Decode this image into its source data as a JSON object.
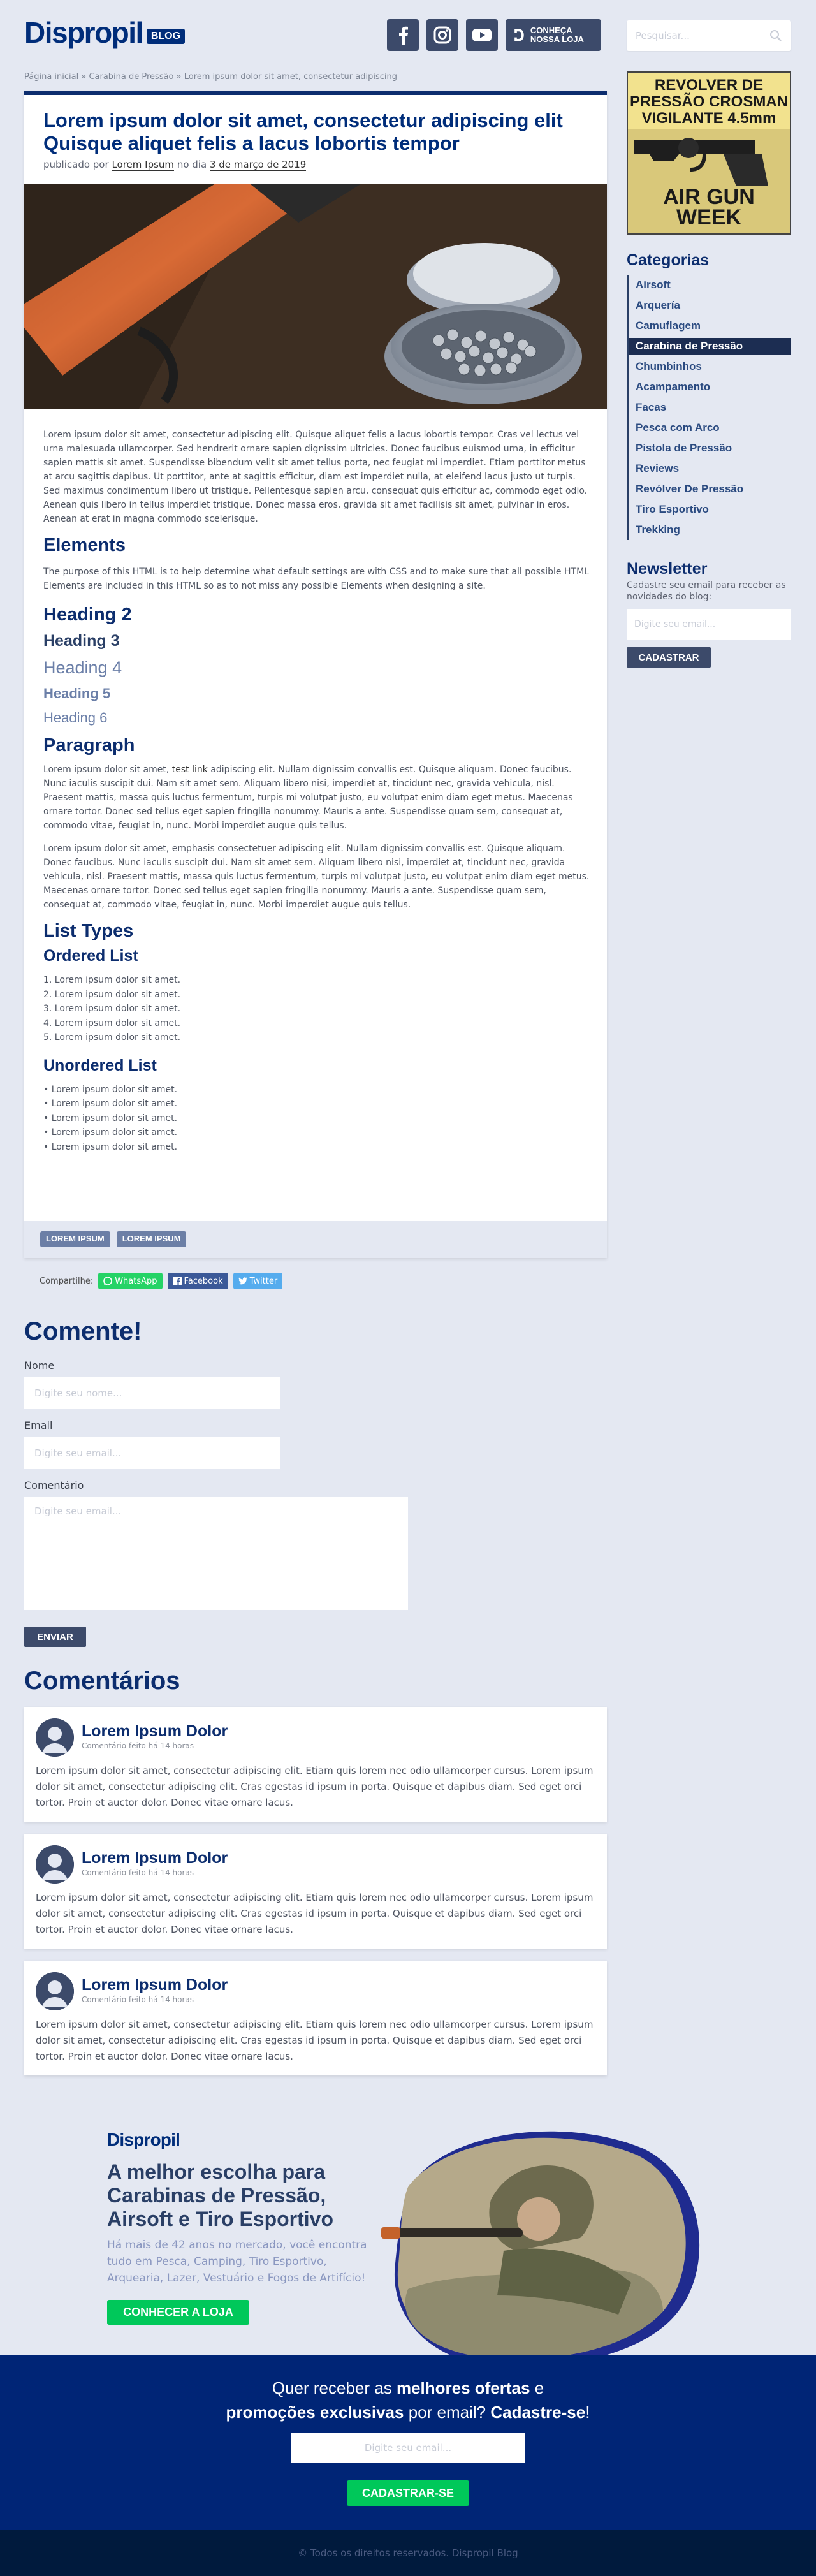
{
  "header": {
    "logo": "Dispropil",
    "logo_badge": "BLOG",
    "store_button": "CONHEÇA NOSSA LOJA",
    "search_placeholder": "Pesquisar..."
  },
  "breadcrumb": "Página inicial » Carabina de Pressão » Lorem ipsum dolor sit amet, consectetur adipiscing",
  "post": {
    "title": "Lorem ipsum dolor sit amet, consectetur adipiscing elit Quisque aliquet felis a lacus lobortis tempor",
    "meta_prefix": "publicado por",
    "author": "Lorem Ipsum",
    "meta_mid": "no dia",
    "date": "3 de março de 2019",
    "intro": "Lorem ipsum dolor sit amet, consectetur adipiscing elit. Quisque aliquet felis a lacus lobortis tempor. Cras vel lectus vel urna malesuada ullamcorper. Sed hendrerit ornare sapien dignissim ultricies. Donec faucibus euismod urna, in efficitur sapien mattis sit amet. Suspendisse bibendum velit sit amet tellus porta, nec feugiat mi imperdiet. Etiam porttitor metus at arcu sagittis dapibus. Ut porttitor, ante at sagittis efficitur, diam est imperdiet nulla, at eleifend lacus justo ut turpis. Sed maximus condimentum libero ut tristique. Pellentesque sapien arcu, consequat quis efficitur ac, commodo eget odio. Aenean quis libero in tellus imperdiet tristique. Donec massa eros, gravida sit amet facilisis sit amet, pulvinar in eros. Aenean at erat in magna commodo scelerisque.",
    "elements_heading": "Elements",
    "elements_text": "The purpose of this HTML is to help determine what default settings are with CSS and to make sure that all possible HTML Elements are included in this HTML so as to not miss any possible Elements when designing a site.",
    "h2": "Heading 2",
    "h3": "Heading 3",
    "h4": "Heading 4",
    "h5": "Heading 5",
    "h6": "Heading 6",
    "paragraph_heading": "Paragraph",
    "para1_a": "Lorem ipsum dolor sit amet,",
    "para1_link": "test link",
    "para1_b": "adipiscing elit. Nullam dignissim convallis est. Quisque aliquam. Donec faucibus. Nunc iaculis suscipit dui. Nam sit amet sem. Aliquam libero nisi, imperdiet at, tincidunt nec, gravida vehicula, nisl. Praesent mattis, massa quis luctus fermentum, turpis mi volutpat justo, eu volutpat enim diam eget metus. Maecenas ornare tortor. Donec sed tellus eget sapien fringilla nonummy. Mauris a ante. Suspendisse quam sem, consequat at, commodo vitae, feugiat in, nunc. Morbi imperdiet augue quis tellus.",
    "para2": "Lorem ipsum dolor sit amet, emphasis consectetuer adipiscing elit. Nullam dignissim convallis est. Quisque aliquam. Donec faucibus. Nunc iaculis suscipit dui. Nam sit amet sem. Aliquam libero nisi, imperdiet at, tincidunt nec, gravida vehicula, nisl. Praesent mattis, massa quis luctus fermentum, turpis mi volutpat justo, eu volutpat enim diam eget metus. Maecenas ornare tortor. Donec sed tellus eget sapien fringilla nonummy. Mauris a ante. Suspendisse quam sem, consequat at, commodo vitae, feugiat in, nunc. Morbi imperdiet augue quis tellus.",
    "list_types_heading": "List Types",
    "ordered_heading": "Ordered List",
    "ordered": [
      "1. Lorem ipsum dolor sit amet.",
      "2. Lorem ipsum dolor sit amet.",
      "3. Lorem ipsum dolor sit amet.",
      "4. Lorem ipsum dolor sit amet.",
      "5. Lorem ipsum dolor sit amet."
    ],
    "unordered_heading": "Unordered List",
    "unordered": [
      "• Lorem ipsum dolor sit amet.",
      "• Lorem ipsum dolor sit amet.",
      "• Lorem ipsum dolor sit amet.",
      "• Lorem ipsum dolor sit amet.",
      "• Lorem ipsum dolor sit amet."
    ],
    "tags": [
      "LOREM IPSUM",
      "LOREM IPSUM"
    ]
  },
  "share": {
    "label": "Compartilhe:",
    "whatsapp": "WhatsApp",
    "facebook": "Facebook",
    "twitter": "Twitter",
    "colors": {
      "whatsapp": "#25d366",
      "facebook": "#3b5998",
      "twitter": "#55acee"
    }
  },
  "sidebar": {
    "ad_top": [
      "REVOLVER DE",
      "PRESSÃO CROSMAN",
      "VIGILANTE 4.5mm"
    ],
    "ad_bottom": [
      "AIR GUN",
      "WEEK"
    ],
    "categories_heading": "Categorias",
    "categories": [
      "Airsoft",
      "Arquería",
      "Camuflagem",
      "Carabina de Pressão",
      "Chumbinhos",
      "Acampamento",
      "Facas",
      "Pesca com Arco",
      "Pistola de Pressão",
      "Reviews",
      "Revólver De Pressão",
      "Tiro Esportivo",
      "Trekking"
    ],
    "active_category": "Carabina de Pressão",
    "newsletter_heading": "Newsletter",
    "newsletter_text": "Cadastre seu email para receber as novidades do blog:",
    "newsletter_placeholder": "Digite seu email...",
    "newsletter_button": "CADASTRAR"
  },
  "comment_form": {
    "title": "Comente!",
    "name_label": "Nome",
    "name_placeholder": "Digite seu nome...",
    "email_label": "Email",
    "email_placeholder": "Digite seu email...",
    "comment_label": "Comentário",
    "comment_placeholder": "Digite seu email...",
    "submit": "ENVIAR"
  },
  "comments": {
    "title": "Comentários",
    "items": [
      {
        "name": "Lorem Ipsum Dolor",
        "time": "Comentário feito há 14 horas",
        "body": "Lorem ipsum dolor sit amet, consectetur adipiscing elit. Etiam quis lorem nec odio ullamcorper cursus. Lorem ipsum dolor sit amet, consectetur adipiscing elit. Cras egestas id ipsum in porta. Quisque et dapibus diam. Sed eget orci tortor. Proin et auctor dolor. Donec vitae ornare lacus."
      },
      {
        "name": "Lorem Ipsum Dolor",
        "time": "Comentário feito há 14 horas",
        "body": "Lorem ipsum dolor sit amet, consectetur adipiscing elit. Etiam quis lorem nec odio ullamcorper cursus. Lorem ipsum dolor sit amet, consectetur adipiscing elit. Cras egestas id ipsum in porta. Quisque et dapibus diam. Sed eget orci tortor. Proin et auctor dolor. Donec vitae ornare lacus."
      },
      {
        "name": "Lorem Ipsum Dolor",
        "time": "Comentário feito há 14 horas",
        "body": "Lorem ipsum dolor sit amet, consectetur adipiscing elit. Etiam quis lorem nec odio ullamcorper cursus. Lorem ipsum dolor sit amet, consectetur adipiscing elit. Cras egestas id ipsum in porta. Quisque et dapibus diam. Sed eget orci tortor. Proin et auctor dolor. Donec vitae ornare lacus."
      }
    ]
  },
  "promo": {
    "logo": "Dispropil",
    "title": "A melhor escolha para Carabinas de Pressão, Airsoft e Tiro Esportivo",
    "text": "Há mais de 42 anos no mercado, você encontra tudo em Pesca, Camping, Tiro Esportivo, Arquearia, Lazer, Vestuário e Fogos de Artifício!",
    "button": "CONHECER A LOJA"
  },
  "banner": {
    "line1_a": "Quer receber as",
    "line1_b": "melhores ofertas",
    "line1_c": "e",
    "line2_a": "promoções exclusivas",
    "line2_b": "por email?",
    "line2_c": "Cadastre-se",
    "line2_d": "!",
    "placeholder": "Digite seu email...",
    "button": "CADASTRAR-SE"
  },
  "footer": "© Todos os direitos reservados. Dispropil Blog"
}
